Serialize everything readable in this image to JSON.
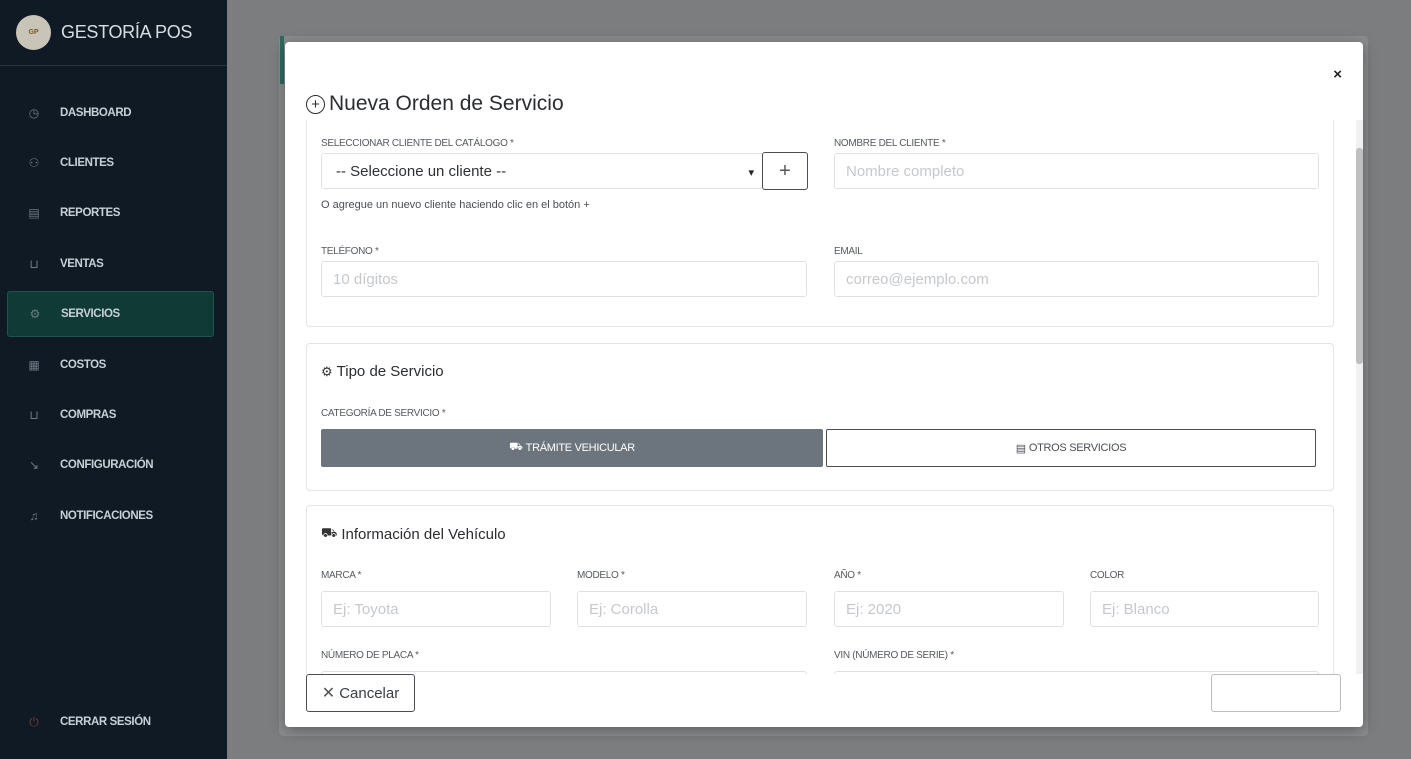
{
  "sidebar": {
    "brand": "GESTORÍA POS",
    "logo_text": "GP",
    "items": [
      {
        "label": "DASHBOARD",
        "icon": "dashboard-icon",
        "glyph": "◷"
      },
      {
        "label": "CLIENTES",
        "icon": "users-icon",
        "glyph": "⚇"
      },
      {
        "label": "REPORTES",
        "icon": "document-icon",
        "glyph": "▤"
      },
      {
        "label": "VENTAS",
        "icon": "cart-icon",
        "glyph": "⊔"
      },
      {
        "label": "SERVICIOS",
        "icon": "gear-icon",
        "glyph": "⚙"
      },
      {
        "label": "COSTOS",
        "icon": "calculator-icon",
        "glyph": "▦"
      },
      {
        "label": "COMPRAS",
        "icon": "cart-icon",
        "glyph": "⊔"
      },
      {
        "label": "CONFIGURACIÓN",
        "icon": "wrench-icon",
        "glyph": "↘"
      },
      {
        "label": "NOTIFICACIONES",
        "icon": "bell-icon",
        "glyph": "♫"
      }
    ],
    "active_index": 4,
    "logout_label": "CERRAR SESIÓN",
    "logout_glyph": "⏻"
  },
  "modal": {
    "title": "Nueva Orden de Servicio",
    "close_label": "×",
    "client": {
      "catalog_label": "SELECCIONAR CLIENTE DEL CATÁLOGO *",
      "catalog_value": "-- Seleccione un cliente --",
      "add_button": "+",
      "hint": "O agregue un nuevo cliente haciendo clic en el botón +",
      "name_label": "NOMBRE DEL CLIENTE *",
      "name_placeholder": "Nombre completo",
      "phone_label": "TELÉFONO *",
      "phone_placeholder": "10 dígitos",
      "email_label": "EMAIL",
      "email_placeholder": "correo@ejemplo.com"
    },
    "service_type": {
      "title": "Tipo de Servicio",
      "category_label": "CATEGORÍA DE SERVICIO *",
      "option_vehicular": "TRÁMITE VEHICULAR",
      "option_other": "OTROS SERVICIOS",
      "selected": "vehicular"
    },
    "vehicle": {
      "title": "Información del Vehículo",
      "brand_label": "MARCA *",
      "brand_placeholder": "Ej: Toyota",
      "model_label": "MODELO *",
      "model_placeholder": "Ej: Corolla",
      "year_label": "AÑO *",
      "year_placeholder": "Ej: 2020",
      "color_label": "COLOR",
      "color_placeholder": "Ej: Blanco",
      "plate_label": "NÚMERO DE PLACA *",
      "vin_label": "VIN (NÚMERO DE SERIE) *"
    },
    "footer": {
      "cancel_label": "Cancelar",
      "save_label": ""
    }
  },
  "colors": {
    "sidebar_bg": "#0f1a24",
    "active_bg": "#0f3a35",
    "toggle_active": "#6c757d"
  }
}
